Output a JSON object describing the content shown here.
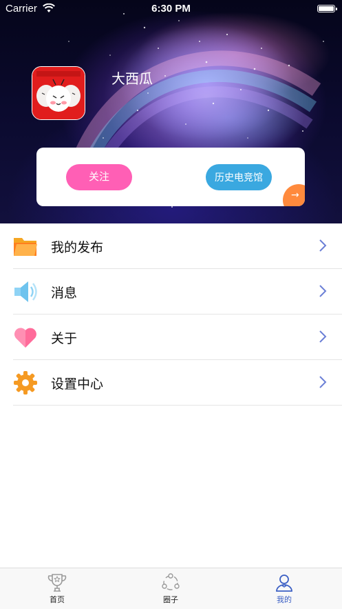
{
  "status_bar": {
    "carrier": "Carrier",
    "time": "6:30 PM"
  },
  "profile": {
    "username": "大西瓜"
  },
  "card": {
    "follow_label": "关注",
    "history_label": "历史电竞馆",
    "corner_arrow": "→"
  },
  "menu": {
    "items": [
      {
        "label": "我的发布",
        "icon": "folder-icon"
      },
      {
        "label": "消息",
        "icon": "speaker-icon"
      },
      {
        "label": "关于",
        "icon": "heart-icon"
      },
      {
        "label": "设置中心",
        "icon": "gear-icon"
      }
    ]
  },
  "tabbar": {
    "tabs": [
      {
        "label": "首页",
        "icon": "trophy-icon"
      },
      {
        "label": "圈子",
        "icon": "circle-nodes-icon"
      },
      {
        "label": "我的",
        "icon": "user-icon",
        "active": true
      }
    ],
    "active_color": "#3b5fc4"
  },
  "colors": {
    "follow_button": "#ff5fb5",
    "history_button": "#3aa8e0",
    "corner_badge": "#ff8a3d",
    "chevron": "#6b7fd6"
  }
}
